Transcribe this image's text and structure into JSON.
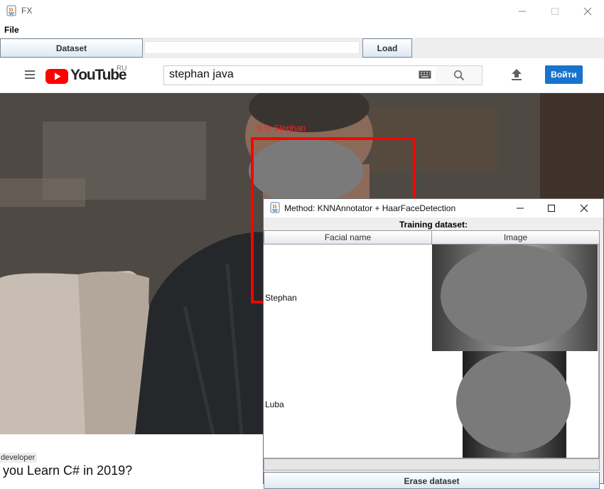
{
  "window": {
    "title": "FX",
    "menu": [
      "File"
    ]
  },
  "toolbar": {
    "dataset_label": "Dataset",
    "path_value": "",
    "load_label": "Load"
  },
  "youtube": {
    "region": "RU",
    "search_value": "stephan java",
    "signin_label": "Войти",
    "logo_text": "YouTube"
  },
  "video": {
    "detection_label": "0.0: Stephan",
    "channel_tag": "developer",
    "title_fragment": "you Learn C# in 2019?"
  },
  "dialog": {
    "title": "Method: KNNAnnotator + HaarFaceDetection",
    "section_label": "Training dataset:",
    "columns": [
      "Facial name",
      "Image"
    ],
    "rows": [
      {
        "name": "Stephan"
      },
      {
        "name": "Luba"
      }
    ],
    "erase_label": "Erase dataset"
  },
  "colors": {
    "detection_box": "#ff0000",
    "youtube_red": "#ff0000",
    "signin_blue": "#1873cc",
    "redaction": "#7a7a7a"
  }
}
